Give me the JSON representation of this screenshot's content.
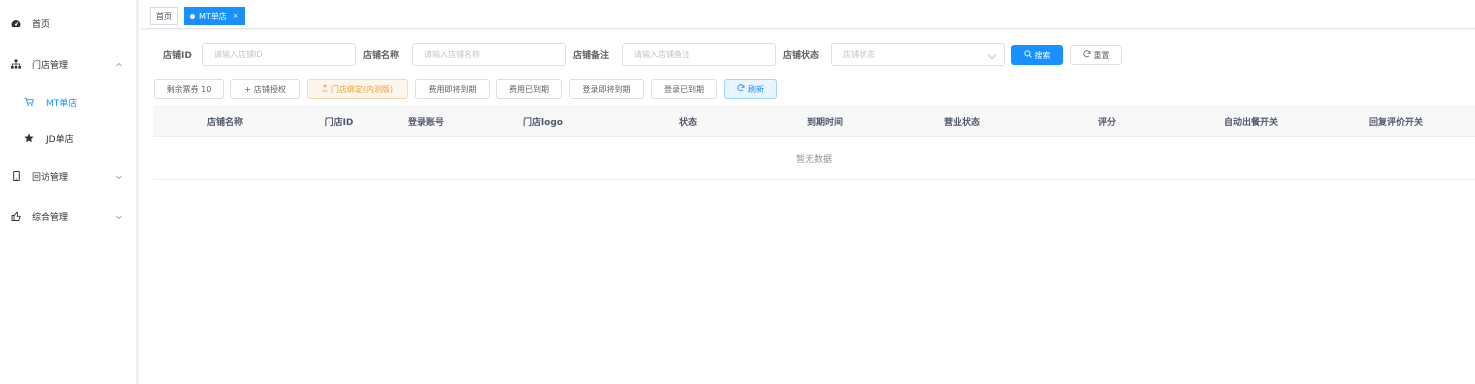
{
  "sidebar": {
    "items": [
      {
        "label": "首页",
        "icon": "dashboard-icon"
      },
      {
        "label": "门店管理",
        "icon": "sitemap-icon"
      },
      {
        "label": "MT单店",
        "icon": "shopping-cart-icon"
      },
      {
        "label": "JD单店",
        "icon": "star-icon"
      },
      {
        "label": "回访管理",
        "icon": "mobile-icon"
      },
      {
        "label": "综合管理",
        "icon": "thumbs-up-icon"
      }
    ]
  },
  "tabs": [
    {
      "label": "首页"
    },
    {
      "label": "MT单店",
      "close": "×"
    }
  ],
  "search": {
    "store_id_label": "店铺ID",
    "store_id_placeholder": "请输入店铺ID",
    "store_name_label": "店铺名称",
    "store_name_placeholder": "请输入店铺名称",
    "store_note_label": "店铺备注",
    "store_note_placeholder": "请输入店铺备注",
    "store_status_label": "店铺状态",
    "store_status_placeholder": "店铺状态",
    "search_button": "搜索",
    "reset_button": "重置"
  },
  "toolbar": {
    "remaining_tickets": "剩余票券 10",
    "authorize": "店铺授权",
    "bind_store": "门店绑定(内测版)",
    "fee_expiring": "费用即将到期",
    "fee_expired": "费用已到期",
    "login_expiring": "登录即将到期",
    "login_expired": "登录已到期",
    "refresh": "刷新"
  },
  "table": {
    "columns": [
      "店铺名称",
      "门店ID",
      "登录账号",
      "门店logo",
      "状态",
      "到期时间",
      "营业状态",
      "评分",
      "自动出餐开关",
      "回复评价开关"
    ],
    "empty_text": "暂无数据"
  },
  "colors": {
    "primary": "#1890ff",
    "warning": "#e6a23c",
    "sidebar_border": "#eef0f3"
  }
}
